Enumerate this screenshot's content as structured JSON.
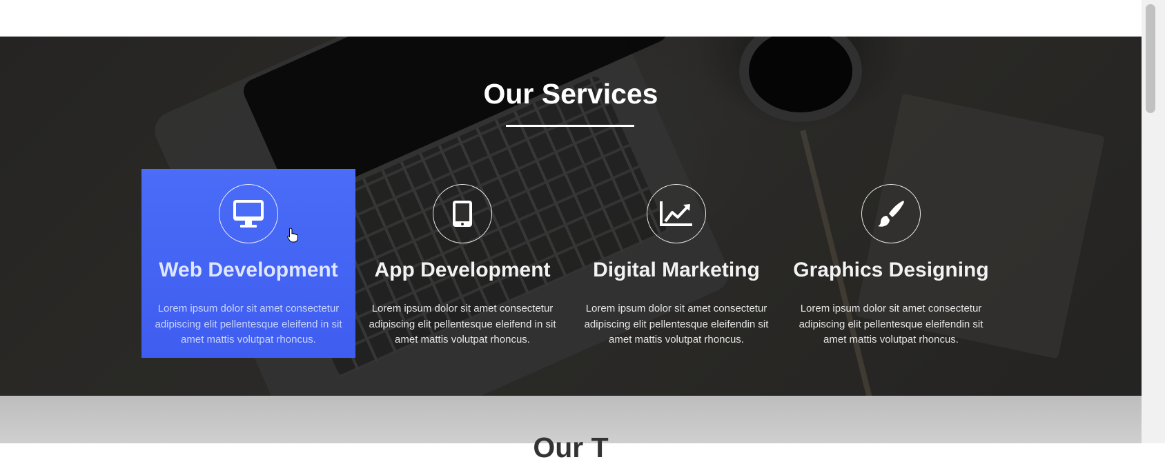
{
  "section": {
    "title": "Our Services"
  },
  "services": [
    {
      "icon": "desktop-icon",
      "title": "Web Development",
      "text": "Lorem ipsum dolor sit amet consectetur adipiscing elit pellentesque eleifend in sit amet mattis volutpat rhoncus.",
      "active": true
    },
    {
      "icon": "tablet-icon",
      "title": "App Development",
      "text": "Lorem ipsum dolor sit amet consectetur adipiscing elit pellentesque eleifend in sit amet mattis volutpat rhoncus.",
      "active": false
    },
    {
      "icon": "chart-line-icon",
      "title": "Digital Marketing",
      "text": "Lorem ipsum dolor sit amet consectetur adipiscing elit pellentesque eleifendin sit amet mattis volutpat rhoncus.",
      "active": false
    },
    {
      "icon": "paint-brush-icon",
      "title": "Graphics Designing",
      "text": "Lorem ipsum dolor sit amet consectetur adipiscing elit pellentesque eleifendin sit amet mattis volutpat rhoncus.",
      "active": false
    }
  ],
  "next_section": {
    "title_partial": "Our T"
  },
  "colors": {
    "accent": "#4a6cf7",
    "dark_overlay": "#2f2e2c",
    "next_section_bg": "#c4c4c4"
  }
}
